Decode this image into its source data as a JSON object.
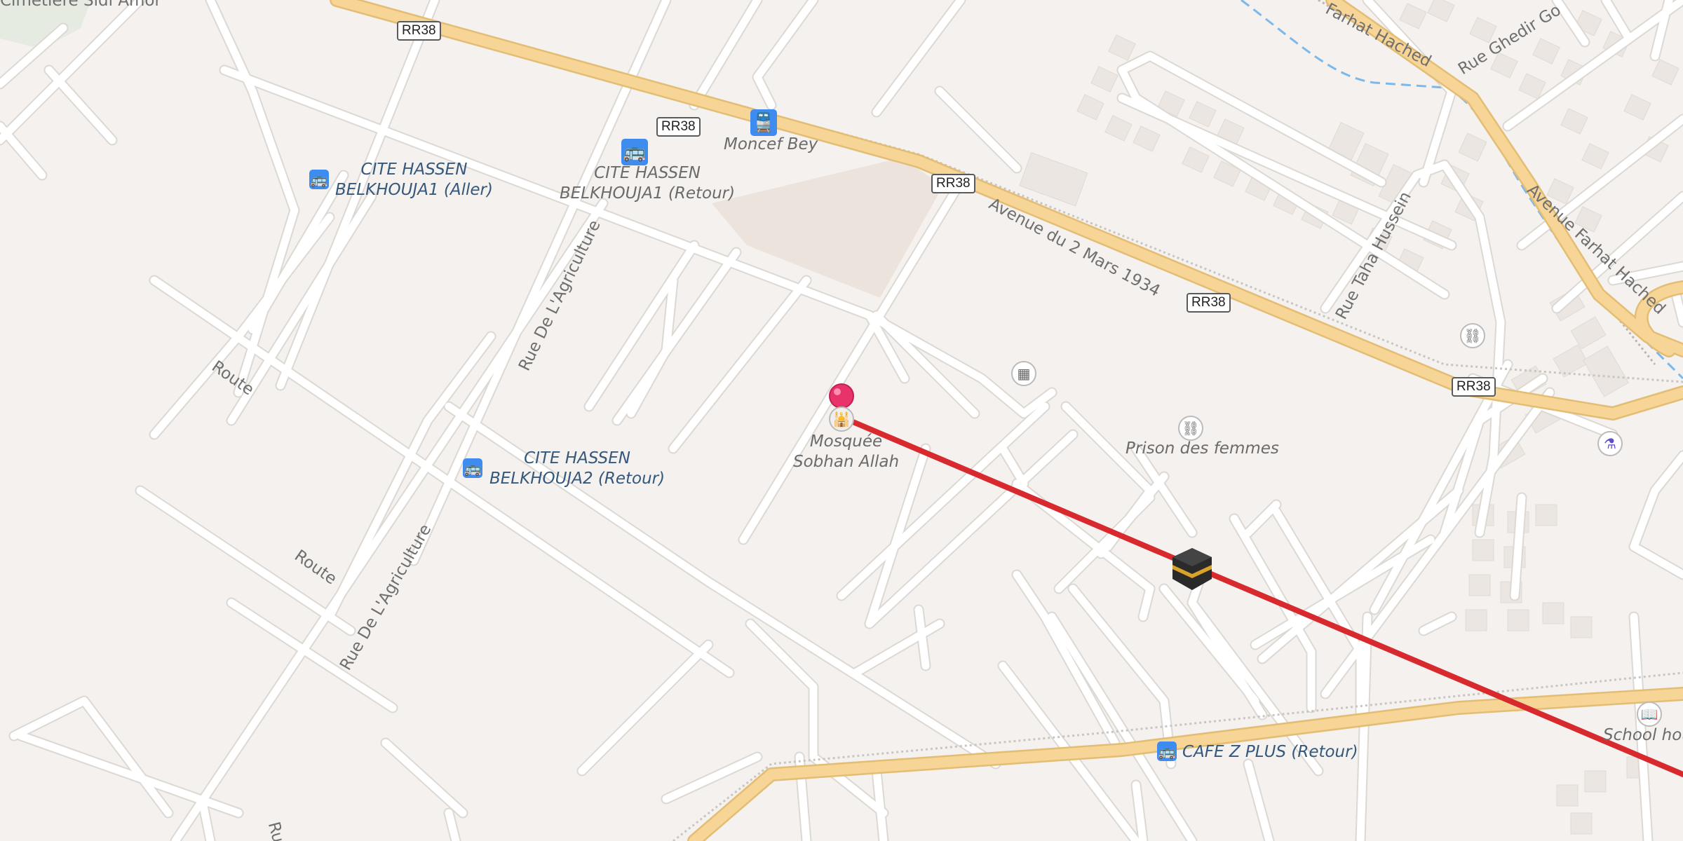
{
  "map": {
    "route_shields": [
      {
        "id": "s1",
        "text": "RR38"
      },
      {
        "id": "s2",
        "text": "RR38"
      },
      {
        "id": "s3",
        "text": "RR38"
      },
      {
        "id": "s4",
        "text": "RR38"
      },
      {
        "id": "s5",
        "text": "RR38"
      }
    ],
    "streets": {
      "avenue_2_mars": "Avenue du 2 Mars 1934",
      "rue_agriculture_1": "Rue De L'Agriculture",
      "rue_agriculture_2": "Rue De L'Agriculture",
      "route_1": "Route",
      "route_2": "Route",
      "rue_taha": "Rue Taha Hussein",
      "avenue_farhat": "Avenue Farhat Hached",
      "farhat_top": "Farhat Hached",
      "rue_ghedir": "Rue Ghedir Go",
      "cemetery": "Cimetière Sidi Amor",
      "bottom_r": "Ru"
    },
    "pois": {
      "moncef_bey": "Moncef Bey",
      "cite_hassen_aller": "CITE HASSEN\nBELKHOUJA1 (Aller)",
      "cite_hassen_retour1": "CITE HASSEN\nBELKHOUJA1 (Retour)",
      "cite_hassen_retour2": "CITE HASSEN\nBELKHOUJA2 (Retour)",
      "mosquee": "Mosquée\nSobhan Allah",
      "prison": "Prison des femmes",
      "cafe": "CAFE Z PLUS (Retour)",
      "school": "School hou"
    },
    "icons": {
      "bus": "bus-icon",
      "train": "train-icon",
      "mosque": "mosque-icon",
      "kaaba": "kaaba-icon",
      "prison": "prison-icon",
      "pharmacy": "pharmacy-icon",
      "school": "book-icon",
      "door": "door-icon",
      "pin": "map-pin-icon"
    },
    "colors": {
      "background": "#f4f1ee",
      "road_major": "#f7d596",
      "road_major_edge": "#e3bd73",
      "road_minor": "#ffffff",
      "road_minor_edge": "#dcd8d3",
      "route_line": "#d8292f",
      "pin": "#e8336a",
      "bus": "#3f8cf0",
      "water": "#7cb8ea",
      "building": "#ebe6e1"
    }
  }
}
